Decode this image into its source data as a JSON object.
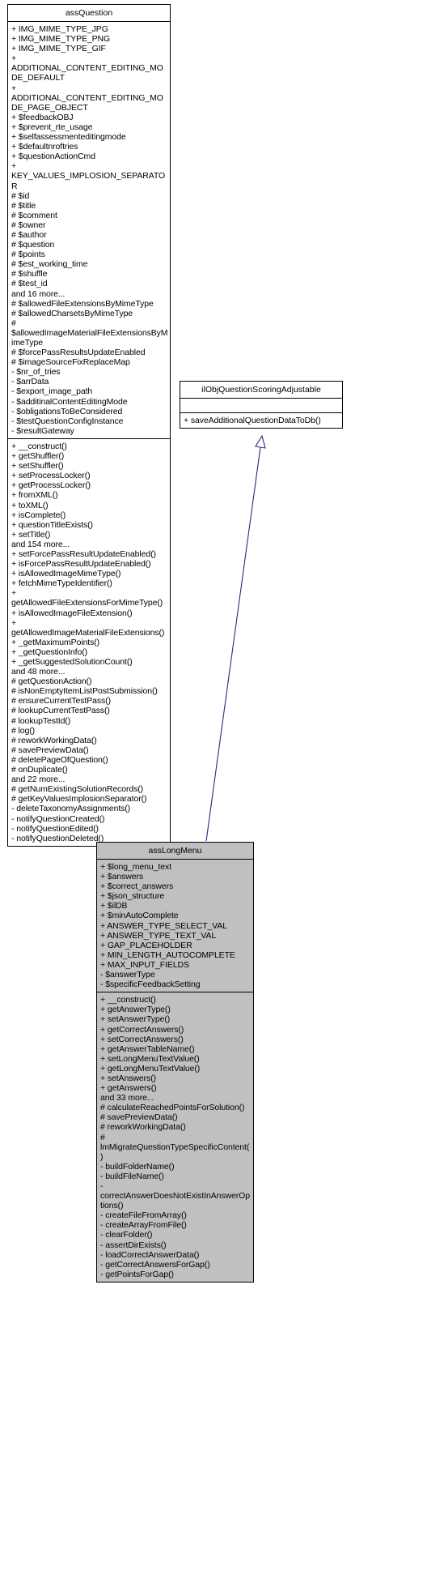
{
  "diagram": {
    "type": "uml-class-diagram",
    "background": "#ffffff",
    "line_color": "#000000",
    "inheritance_arrow_color": "#1f1f8f",
    "filled_class_fill": "#c0c0c0"
  },
  "classes": {
    "assQuestion": {
      "name": "assQuestion",
      "style": "plain",
      "attributes": [
        "+ IMG_MIME_TYPE_JPG",
        "+ IMG_MIME_TYPE_PNG",
        "+ IMG_MIME_TYPE_GIF",
        "+ ADDITIONAL_CONTENT_EDITING_MODE_DEFAULT",
        "+ ADDITIONAL_CONTENT_EDITING_MODE_PAGE_OBJECT",
        "+ $feedbackOBJ",
        "+ $prevent_rte_usage",
        "+ $selfassessmenteditingmode",
        "+ $defaultnroftries",
        "+ $questionActionCmd",
        "+ KEY_VALUES_IMPLOSION_SEPARATOR",
        "# $id",
        "# $title",
        "# $comment",
        "# $owner",
        "# $author",
        "# $question",
        "# $points",
        "# $est_working_time",
        "# $shuffle",
        "# $test_id",
        "and 16 more...",
        "# $allowedFileExtensionsByMimeType",
        "# $allowedCharsetsByMimeType",
        "# $allowedImageMaterialFileExtensionsByMimeType",
        "# $forcePassResultsUpdateEnabled",
        "# $imageSourceFixReplaceMap",
        "- $nr_of_tries",
        "- $arrData",
        "- $export_image_path",
        "- $additinalContentEditingMode",
        "- $obligationsToBeConsidered",
        "- $testQuestionConfigInstance",
        "- $resultGateway"
      ],
      "operations": [
        "+ __construct()",
        "+ getShuffler()",
        "+ setShuffler()",
        "+ setProcessLocker()",
        "+ getProcessLocker()",
        "+ fromXML()",
        "+ toXML()",
        "+ isComplete()",
        "+ questionTitleExists()",
        "+ setTitle()",
        "and 154 more...",
        "+ setForcePassResultUpdateEnabled()",
        "+ isForcePassResultUpdateEnabled()",
        "+ isAllowedImageMimeType()",
        "+ fetchMimeTypeIdentifier()",
        "+ getAllowedFileExtensionsForMimeType()",
        "+ isAllowedImageFileExtension()",
        "+ getAllowedImageMaterialFileExtensions()",
        "+ _getMaximumPoints()",
        "+ _getQuestionInfo()",
        "+ _getSuggestedSolutionCount()",
        "and 48 more...",
        "# getQuestionAction()",
        "# isNonEmptyItemListPostSubmission()",
        "# ensureCurrentTestPass()",
        "# lookupCurrentTestPass()",
        "# lookupTestId()",
        "# log()",
        "# reworkWorkingData()",
        "# savePreviewData()",
        "# deletePageOfQuestion()",
        "# onDuplicate()",
        "and 22 more...",
        "# getNumExistingSolutionRecords()",
        "# getKeyValuesImplosionSeparator()",
        "- deleteTaxonomyAssignments()",
        "- notifyQuestionCreated()",
        "- notifyQuestionEdited()",
        "- notifyQuestionDeleted()"
      ]
    },
    "ilObjQuestionScoringAdjustable": {
      "name": "ilObjQuestionScoringAdjustable",
      "style": "plain",
      "attributes": [],
      "operations": [
        "+ saveAdditionalQuestionDataToDb()"
      ]
    },
    "assLongMenu": {
      "name": "assLongMenu",
      "style": "filled",
      "attributes": [
        "+ $long_menu_text",
        "+ $answers",
        "+ $correct_answers",
        "+ $json_structure",
        "+ $ilDB",
        "+ $minAutoComplete",
        "+ ANSWER_TYPE_SELECT_VAL",
        "+ ANSWER_TYPE_TEXT_VAL",
        "+ GAP_PLACEHOLDER",
        "+ MIN_LENGTH_AUTOCOMPLETE",
        "+ MAX_INPUT_FIELDS",
        "- $answerType",
        "- $specificFeedbackSetting"
      ],
      "operations": [
        "+ __construct()",
        "+ getAnswerType()",
        "+ setAnswerType()",
        "+ getCorrectAnswers()",
        "+ setCorrectAnswers()",
        "+ getAnswerTableName()",
        "+ setLongMenuTextValue()",
        "+ getLongMenuTextValue()",
        "+ setAnswers()",
        "+ getAnswers()",
        "and 33 more...",
        "# calculateReachedPointsForSolution()",
        "# savePreviewData()",
        "# reworkWorkingData()",
        "# lmMigrateQuestionTypeSpecificContent()",
        "- buildFolderName()",
        "- buildFileName()",
        "- correctAnswerDoesNotExistInAnswerOptions()",
        "- createFileFromArray()",
        "- createArrayFromFile()",
        "- clearFolder()",
        "- assertDirExists()",
        "- loadCorrectAnswerData()",
        "- getCorrectAnswersForGap()",
        "- getPointsForGap()"
      ]
    }
  },
  "relationships": [
    {
      "from": "assLongMenu",
      "to": "assQuestion",
      "type": "generalization"
    },
    {
      "from": "assLongMenu",
      "to": "ilObjQuestionScoringAdjustable",
      "type": "realization"
    }
  ]
}
